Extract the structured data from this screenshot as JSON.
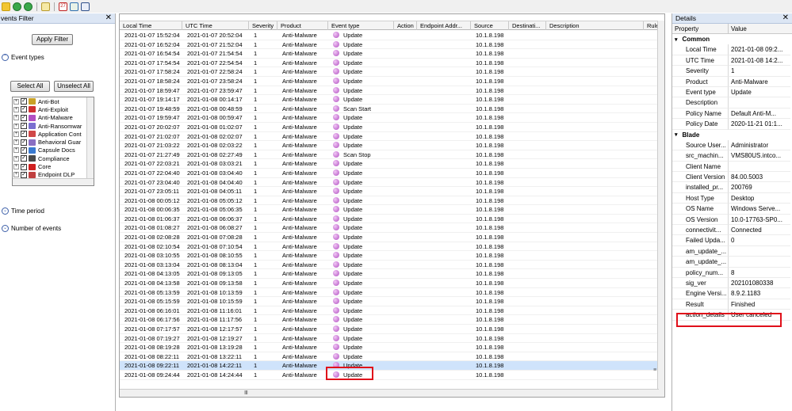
{
  "toolbar": {
    "icons": [
      "run-icon",
      "refresh-icon",
      "refresh-all-icon",
      "copy-icon",
      "calendar-icon",
      "tree-view-icon",
      "document-icon"
    ],
    "calendar_text": "27"
  },
  "filter_pane": {
    "title": "Events Filter",
    "title_visible": "vents Filter",
    "close_glyph": "✕",
    "apply_label": "Apply Filter",
    "event_types_label": "Event types",
    "select_all_label": "Select All",
    "unselect_all_label": "Unselect All",
    "tree_items": [
      {
        "label": "Anti-Bot",
        "color": "#c9a227"
      },
      {
        "label": "Anti-Exploit",
        "color": "#d03030"
      },
      {
        "label": "Anti-Malware",
        "color": "#b24fc2"
      },
      {
        "label": "Anti-Ransomwar",
        "color": "#7a6fd0"
      },
      {
        "label": "Application Cont",
        "color": "#d04848"
      },
      {
        "label": "Behavioral Guar",
        "color": "#8a6fc2"
      },
      {
        "label": "Capsule Docs",
        "color": "#3a7ad0"
      },
      {
        "label": "Compliance",
        "color": "#4a4a4a"
      },
      {
        "label": "Core",
        "color": "#d02020"
      },
      {
        "label": "Endpoint DLP",
        "color": "#c04040"
      }
    ],
    "time_period_label": "Time period",
    "number_of_events_label": "Number of events"
  },
  "grid": {
    "columns": [
      "Local Time",
      "UTC Time",
      "Severity",
      "Product",
      "Event type",
      "Action",
      "Endpoint Addr...",
      "Source",
      "Destinati...",
      "Description",
      "Rule"
    ],
    "selected_index": 36,
    "rows": [
      {
        "local": "2021-01-07 15:52:04",
        "utc": "2021-01-07 20:52:04",
        "sev": "1",
        "product": "Anti-Malware",
        "event": "Update",
        "source": "10.1.8.198"
      },
      {
        "local": "2021-01-07 16:52:04",
        "utc": "2021-01-07 21:52:04",
        "sev": "1",
        "product": "Anti-Malware",
        "event": "Update",
        "source": "10.1.8.198"
      },
      {
        "local": "2021-01-07 16:54:54",
        "utc": "2021-01-07 21:54:54",
        "sev": "1",
        "product": "Anti-Malware",
        "event": "Update",
        "source": "10.1.8.198"
      },
      {
        "local": "2021-01-07 17:54:54",
        "utc": "2021-01-07 22:54:54",
        "sev": "1",
        "product": "Anti-Malware",
        "event": "Update",
        "source": "10.1.8.198"
      },
      {
        "local": "2021-01-07 17:58:24",
        "utc": "2021-01-07 22:58:24",
        "sev": "1",
        "product": "Anti-Malware",
        "event": "Update",
        "source": "10.1.8.198"
      },
      {
        "local": "2021-01-07 18:58:24",
        "utc": "2021-01-07 23:58:24",
        "sev": "1",
        "product": "Anti-Malware",
        "event": "Update",
        "source": "10.1.8.198"
      },
      {
        "local": "2021-01-07 18:59:47",
        "utc": "2021-01-07 23:59:47",
        "sev": "1",
        "product": "Anti-Malware",
        "event": "Update",
        "source": "10.1.8.198"
      },
      {
        "local": "2021-01-07 19:14:17",
        "utc": "2021-01-08 00:14:17",
        "sev": "1",
        "product": "Anti-Malware",
        "event": "Update",
        "source": "10.1.8.198"
      },
      {
        "local": "2021-01-07 19:48:59",
        "utc": "2021-01-08 00:48:59",
        "sev": "1",
        "product": "Anti-Malware",
        "event": "Scan Start",
        "source": "10.1.8.198"
      },
      {
        "local": "2021-01-07 19:59:47",
        "utc": "2021-01-08 00:59:47",
        "sev": "1",
        "product": "Anti-Malware",
        "event": "Update",
        "source": "10.1.8.198"
      },
      {
        "local": "2021-01-07 20:02:07",
        "utc": "2021-01-08 01:02:07",
        "sev": "1",
        "product": "Anti-Malware",
        "event": "Update",
        "source": "10.1.8.198"
      },
      {
        "local": "2021-01-07 21:02:07",
        "utc": "2021-01-08 02:02:07",
        "sev": "1",
        "product": "Anti-Malware",
        "event": "Update",
        "source": "10.1.8.198"
      },
      {
        "local": "2021-01-07 21:03:22",
        "utc": "2021-01-08 02:03:22",
        "sev": "1",
        "product": "Anti-Malware",
        "event": "Update",
        "source": "10.1.8.198"
      },
      {
        "local": "2021-01-07 21:27:49",
        "utc": "2021-01-08 02:27:49",
        "sev": "1",
        "product": "Anti-Malware",
        "event": "Scan Stop",
        "source": "10.1.8.198"
      },
      {
        "local": "2021-01-07 22:03:21",
        "utc": "2021-01-08 03:03:21",
        "sev": "1",
        "product": "Anti-Malware",
        "event": "Update",
        "source": "10.1.8.198"
      },
      {
        "local": "2021-01-07 22:04:40",
        "utc": "2021-01-08 03:04:40",
        "sev": "1",
        "product": "Anti-Malware",
        "event": "Update",
        "source": "10.1.8.198"
      },
      {
        "local": "2021-01-07 23:04:40",
        "utc": "2021-01-08 04:04:40",
        "sev": "1",
        "product": "Anti-Malware",
        "event": "Update",
        "source": "10.1.8.198"
      },
      {
        "local": "2021-01-07 23:05:11",
        "utc": "2021-01-08 04:05:11",
        "sev": "1",
        "product": "Anti-Malware",
        "event": "Update",
        "source": "10.1.8.198"
      },
      {
        "local": "2021-01-08 00:05:12",
        "utc": "2021-01-08 05:05:12",
        "sev": "1",
        "product": "Anti-Malware",
        "event": "Update",
        "source": "10.1.8.198"
      },
      {
        "local": "2021-01-08 00:06:35",
        "utc": "2021-01-08 05:06:35",
        "sev": "1",
        "product": "Anti-Malware",
        "event": "Update",
        "source": "10.1.8.198"
      },
      {
        "local": "2021-01-08 01:06:37",
        "utc": "2021-01-08 06:06:37",
        "sev": "1",
        "product": "Anti-Malware",
        "event": "Update",
        "source": "10.1.8.198"
      },
      {
        "local": "2021-01-08 01:08:27",
        "utc": "2021-01-08 06:08:27",
        "sev": "1",
        "product": "Anti-Malware",
        "event": "Update",
        "source": "10.1.8.198"
      },
      {
        "local": "2021-01-08 02:08:28",
        "utc": "2021-01-08 07:08:28",
        "sev": "1",
        "product": "Anti-Malware",
        "event": "Update",
        "source": "10.1.8.198"
      },
      {
        "local": "2021-01-08 02:10:54",
        "utc": "2021-01-08 07:10:54",
        "sev": "1",
        "product": "Anti-Malware",
        "event": "Update",
        "source": "10.1.8.198"
      },
      {
        "local": "2021-01-08 03:10:55",
        "utc": "2021-01-08 08:10:55",
        "sev": "1",
        "product": "Anti-Malware",
        "event": "Update",
        "source": "10.1.8.198"
      },
      {
        "local": "2021-01-08 03:13:04",
        "utc": "2021-01-08 08:13:04",
        "sev": "1",
        "product": "Anti-Malware",
        "event": "Update",
        "source": "10.1.8.198"
      },
      {
        "local": "2021-01-08 04:13:05",
        "utc": "2021-01-08 09:13:05",
        "sev": "1",
        "product": "Anti-Malware",
        "event": "Update",
        "source": "10.1.8.198"
      },
      {
        "local": "2021-01-08 04:13:58",
        "utc": "2021-01-08 09:13:58",
        "sev": "1",
        "product": "Anti-Malware",
        "event": "Update",
        "source": "10.1.8.198"
      },
      {
        "local": "2021-01-08 05:13:59",
        "utc": "2021-01-08 10:13:59",
        "sev": "1",
        "product": "Anti-Malware",
        "event": "Update",
        "source": "10.1.8.198"
      },
      {
        "local": "2021-01-08 05:15:59",
        "utc": "2021-01-08 10:15:59",
        "sev": "1",
        "product": "Anti-Malware",
        "event": "Update",
        "source": "10.1.8.198"
      },
      {
        "local": "2021-01-08 06:16:01",
        "utc": "2021-01-08 11:16:01",
        "sev": "1",
        "product": "Anti-Malware",
        "event": "Update",
        "source": "10.1.8.198"
      },
      {
        "local": "2021-01-08 06:17:56",
        "utc": "2021-01-08 11:17:56",
        "sev": "1",
        "product": "Anti-Malware",
        "event": "Update",
        "source": "10.1.8.198"
      },
      {
        "local": "2021-01-08 07:17:57",
        "utc": "2021-01-08 12:17:57",
        "sev": "1",
        "product": "Anti-Malware",
        "event": "Update",
        "source": "10.1.8.198"
      },
      {
        "local": "2021-01-08 07:19:27",
        "utc": "2021-01-08 12:19:27",
        "sev": "1",
        "product": "Anti-Malware",
        "event": "Update",
        "source": "10.1.8.198"
      },
      {
        "local": "2021-01-08 08:19:28",
        "utc": "2021-01-08 13:19:28",
        "sev": "1",
        "product": "Anti-Malware",
        "event": "Update",
        "source": "10.1.8.198"
      },
      {
        "local": "2021-01-08 08:22:11",
        "utc": "2021-01-08 13:22:11",
        "sev": "1",
        "product": "Anti-Malware",
        "event": "Update",
        "source": "10.1.8.198"
      },
      {
        "local": "2021-01-08 09:22:11",
        "utc": "2021-01-08 14:22:11",
        "sev": "1",
        "product": "Anti-Malware",
        "event": "Update",
        "source": "10.1.8.198"
      },
      {
        "local": "2021-01-08 09:24:44",
        "utc": "2021-01-08 14:24:44",
        "sev": "1",
        "product": "Anti-Malware",
        "event": "Update",
        "source": "10.1.8.198"
      }
    ]
  },
  "details": {
    "title": "Details",
    "close_glyph": "✕",
    "col_property": "Property",
    "col_value": "Value",
    "groups": [
      {
        "name": "Common",
        "rows": [
          {
            "key": "Local Time",
            "value": "2021-01-08 09:2..."
          },
          {
            "key": "UTC Time",
            "value": "2021-01-08 14:2..."
          },
          {
            "key": "Severity",
            "value": "1"
          },
          {
            "key": "Product",
            "value": "Anti-Malware"
          },
          {
            "key": "Event type",
            "value": "Update"
          },
          {
            "key": "Description",
            "value": ""
          },
          {
            "key": "Policy Name",
            "value": "Default Anti-M..."
          },
          {
            "key": "Policy Date",
            "value": "2020-11-21 01:1..."
          }
        ]
      },
      {
        "name": "Blade",
        "rows": [
          {
            "key": "Source User...",
            "value": "Administrator"
          },
          {
            "key": "src_machin...",
            "value": "VMS80US.intco..."
          },
          {
            "key": "Client Name",
            "value": ""
          },
          {
            "key": "Client Version",
            "value": "84.00.5003"
          },
          {
            "key": "installed_pr...",
            "value": "200769"
          },
          {
            "key": "Host Type",
            "value": "Desktop"
          },
          {
            "key": "OS Name",
            "value": "Windows Serve..."
          },
          {
            "key": "OS Version",
            "value": "10.0-17763-SP0..."
          },
          {
            "key": "connectivit...",
            "value": "Connected"
          },
          {
            "key": "Failed Upda...",
            "value": "0"
          },
          {
            "key": "am_update_...",
            "value": ""
          },
          {
            "key": "am_update_...",
            "value": ""
          },
          {
            "key": "policy_num...",
            "value": "8"
          },
          {
            "key": "sig_ver",
            "value": "202101080338"
          },
          {
            "key": "Engine Versi...",
            "value": "8.9.2.1183"
          },
          {
            "key": "Result",
            "value": "Finished"
          },
          {
            "key": "action_details",
            "value": "User canceled"
          }
        ]
      }
    ]
  },
  "colors": {
    "highlight": "#e0101a",
    "selection": "#cfe3fb",
    "pane_header": "#dce6f4"
  }
}
